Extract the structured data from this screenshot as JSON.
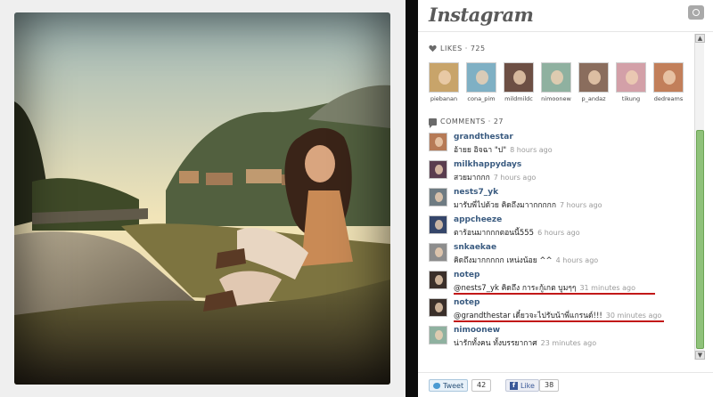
{
  "app": {
    "brand": "Instagram"
  },
  "likes": {
    "label": "LIKES · 725",
    "users": [
      {
        "name": "piebanan",
        "color": "#c8a46a"
      },
      {
        "name": "cona_pim",
        "color": "#7fb0c4"
      },
      {
        "name": "mildmildc",
        "color": "#6d4f44"
      },
      {
        "name": "nimoonew",
        "color": "#8fb1a0"
      },
      {
        "name": "p_andaz",
        "color": "#8a6d5d"
      },
      {
        "name": "tikung",
        "color": "#d3a0a8"
      },
      {
        "name": "dedreams",
        "color": "#c27f5a"
      }
    ]
  },
  "comments": {
    "label": "COMMENTS · 27",
    "items": [
      {
        "user": "grandthestar",
        "text": "อ้ายย อิจฉา \"ป\"",
        "time": "8 hours ago",
        "color": "#b67a56"
      },
      {
        "user": "milkhappydays",
        "text": "สวยมากกก",
        "time": "7 hours ago",
        "color": "#5a3d4f"
      },
      {
        "user": "nests7_yk",
        "text": "มารับพี่ไปด้วย คิดถึงมาากกกกก",
        "time": "7 hours ago",
        "color": "#6e7b82"
      },
      {
        "user": "appcheeze",
        "text": "ตาร้อนมากกกตอนนี้555",
        "time": "6 hours ago",
        "color": "#35466a"
      },
      {
        "user": "snkaekae",
        "text": "คิดถึงมากกกกก เหน่งน้อย ^^",
        "time": "4 hours ago",
        "color": "#8d8d8d"
      },
      {
        "user": "notep",
        "text": "@nests7_yk คิดถึง การะกู้เกต บูมๆๆ",
        "time": "31 minutes ago",
        "color": "#3a2f2a"
      },
      {
        "user": "notep",
        "text": "@grandthestar เดี๋ยวจะไปรับน้าพี่แกรนด์!!!",
        "time": "30 minutes ago",
        "color": "#3a2f2a"
      },
      {
        "user": "nimoonew",
        "text": "น่ารักทั้งคน ทั้งบรรยากาศ",
        "time": "23 minutes ago",
        "color": "#8fb1a0"
      }
    ]
  },
  "footer": {
    "tweet_label": "Tweet",
    "tweet_count": "42",
    "like_label": "Like",
    "like_count": "38"
  }
}
